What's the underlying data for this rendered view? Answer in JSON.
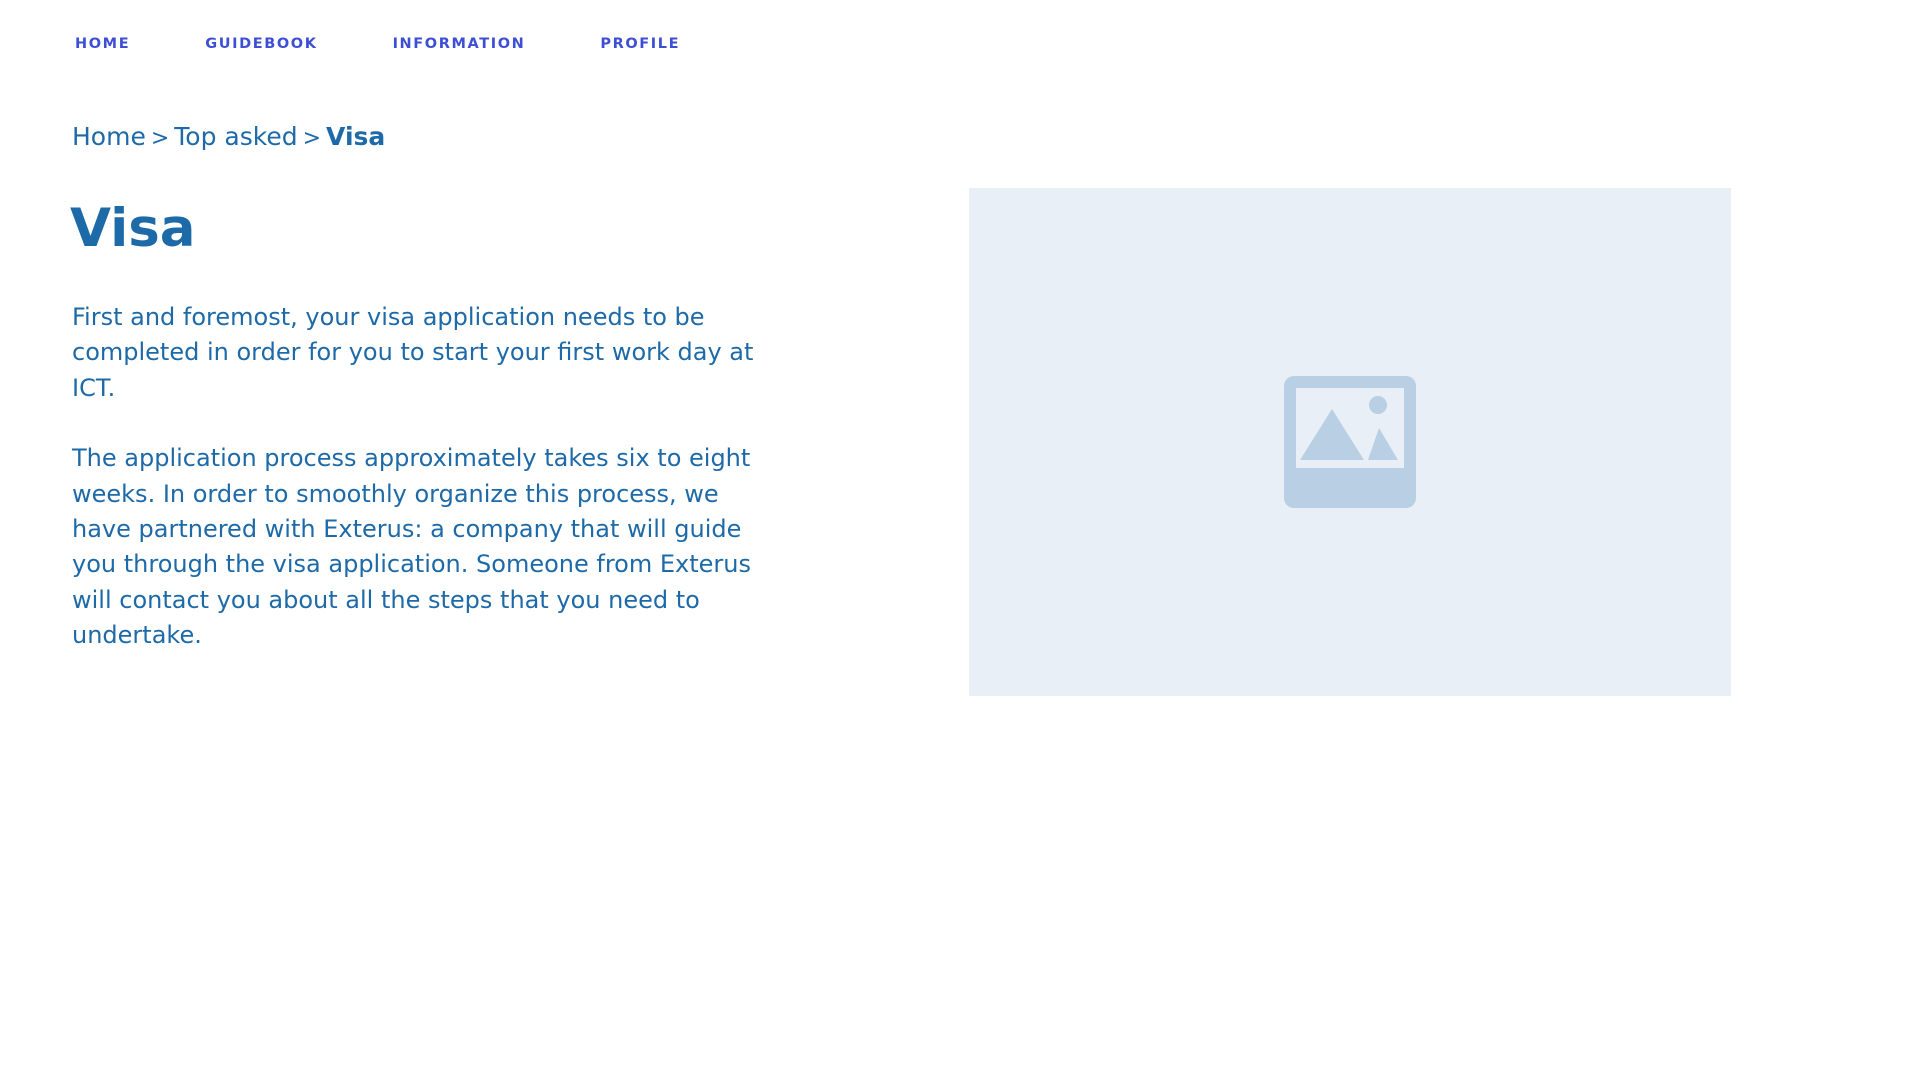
{
  "nav": {
    "items": [
      {
        "label": "HOME"
      },
      {
        "label": "GUIDEBOOK"
      },
      {
        "label": "INFORMATION"
      },
      {
        "label": "PROFILE"
      }
    ]
  },
  "breadcrumb": {
    "home": "Home",
    "separator": ">",
    "section": "Top asked",
    "current": "Visa"
  },
  "page": {
    "title": "Visa",
    "paragraphs": [
      "First and foremost, your visa application needs to be completed in order for you to start your first work day at ICT.",
      "The application process approximately takes six to eight weeks. In order to smoothly organize this process, we have partnered with Exterus: a company that will guide you through the visa application. Someone from Exterus will contact you about all the steps that you need to undertake."
    ]
  },
  "image": {
    "icon": "image-placeholder-icon"
  },
  "colors": {
    "nav": "#3e4fd6",
    "text": "#1e6aa8",
    "image_bg": "#e8eff7",
    "image_icon": "#b9cfe4"
  }
}
